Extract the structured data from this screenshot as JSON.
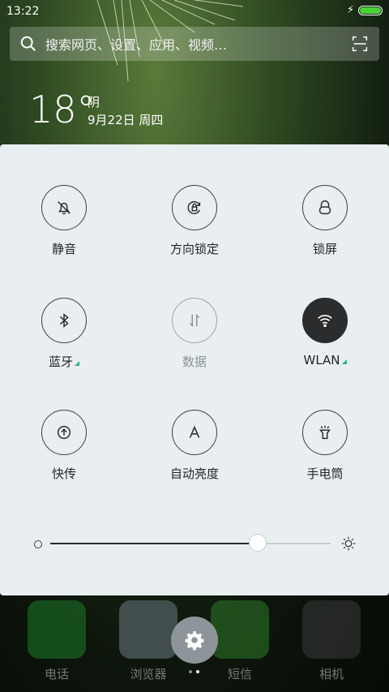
{
  "status_bar": {
    "time": "13:22",
    "charging_icon": "bolt-icon",
    "battery_color": "#4cd137"
  },
  "search": {
    "placeholder": "搜索网页、设置、应用、视频…",
    "icon": "search-icon",
    "scan_icon": "scan-icon"
  },
  "weather": {
    "temperature": "18°",
    "condition": "阴",
    "date": "9月22日 周四"
  },
  "quick_settings": {
    "tiles": [
      {
        "label": "静音",
        "icon": "bell-off-icon"
      },
      {
        "label": "方向锁定",
        "icon": "rotation-lock-icon"
      },
      {
        "label": "锁屏",
        "icon": "lock-icon"
      },
      {
        "label": "蓝牙",
        "icon": "bluetooth-icon"
      },
      {
        "label": "数据",
        "icon": "data-icon",
        "state": "disabled"
      },
      {
        "label": "WLAN",
        "icon": "wifi-icon",
        "state": "active"
      },
      {
        "label": "快传",
        "icon": "transfer-icon"
      },
      {
        "label": "自动亮度",
        "icon": "auto-brightness-icon"
      },
      {
        "label": "手电筒",
        "icon": "flashlight-icon"
      }
    ],
    "brightness_level": 0.74,
    "accent_color": "#3aa79a"
  },
  "dock": {
    "apps": [
      {
        "label": "电话",
        "icon": "phone-icon"
      },
      {
        "label": "浏览器",
        "icon": "browser-icon"
      },
      {
        "label": "短信",
        "icon": "message-icon"
      },
      {
        "label": "相机",
        "icon": "camera-icon"
      }
    ],
    "settings_icon": "gear-icon",
    "page_indicator": {
      "pages": 2,
      "current": 2
    }
  }
}
